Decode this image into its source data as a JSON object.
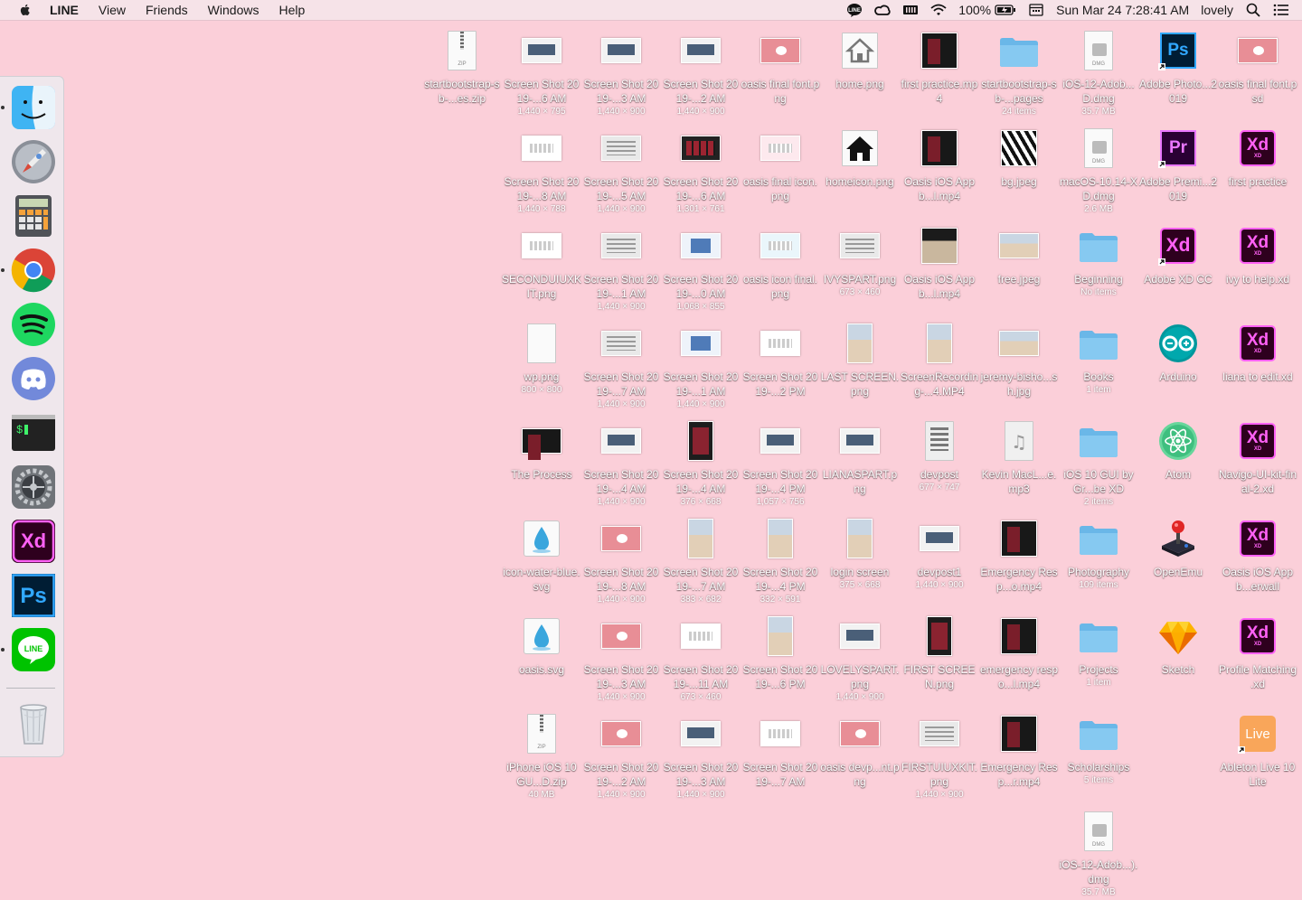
{
  "menubar": {
    "app_name": "LINE",
    "menus": [
      "View",
      "Friends",
      "Windows",
      "Help"
    ],
    "battery": "100%",
    "datetime": "Sun Mar 24  7:28:41 AM",
    "user": "lovely"
  },
  "dock": {
    "apps": [
      {
        "name": "Finder",
        "icon": "finder-icon",
        "running": true
      },
      {
        "name": "Launchpad",
        "icon": "launchpad-icon",
        "running": false
      },
      {
        "name": "Calculator",
        "icon": "calculator-icon",
        "running": false
      },
      {
        "name": "Google Chrome",
        "icon": "chrome-icon",
        "running": true
      },
      {
        "name": "Spotify",
        "icon": "spotify-icon",
        "running": false
      },
      {
        "name": "Discord",
        "icon": "discord-icon",
        "running": false
      },
      {
        "name": "Terminal",
        "icon": "terminal-icon",
        "running": false
      },
      {
        "name": "System Preferences",
        "icon": "system-preferences-icon",
        "running": false
      },
      {
        "name": "Adobe XD",
        "icon": "adobe-xd-icon",
        "running": false
      },
      {
        "name": "Adobe Photoshop",
        "icon": "photoshop-icon",
        "running": false
      },
      {
        "name": "LINE",
        "icon": "line-icon",
        "running": true
      },
      {
        "name": "Trash",
        "icon": "trash-icon",
        "running": false
      }
    ]
  },
  "desktop": {
    "columns": [
      [
        {
          "name": "startbootstrap-sb-...es.zip",
          "info": "",
          "kind": "zip"
        }
      ],
      [
        {
          "name": "Screen Shot 2019-...6 AM",
          "info": "1,440 × 795",
          "kind": "screen"
        },
        {
          "name": "Screen Shot 2019-...8 AM",
          "info": "1,440 × 788",
          "kind": "white"
        },
        {
          "name": "SECONDUIUXKIT.png",
          "info": "",
          "kind": "white"
        },
        {
          "name": "wp.png",
          "info": "800 × 800",
          "kind": "doc-white"
        },
        {
          "name": "The Process",
          "info": "",
          "kind": "video"
        },
        {
          "name": "icon-water-blue.svg",
          "info": "",
          "kind": "water"
        },
        {
          "name": "oasis.svg",
          "info": "",
          "kind": "water"
        },
        {
          "name": "iPhone iOS 10 GU...D.zip",
          "info": "40 MB",
          "kind": "zip"
        }
      ],
      [
        {
          "name": "Screen Shot 2019-...3 AM",
          "info": "1,440 × 900",
          "kind": "screen"
        },
        {
          "name": "Screen Shot 2019-...5 AM",
          "info": "1,440 × 900",
          "kind": "grey"
        },
        {
          "name": "Screen Shot 2019-...1 AM",
          "info": "1,440 × 900",
          "kind": "grey"
        },
        {
          "name": "Screen Shot 2019-...7 AM",
          "info": "1,440 × 900",
          "kind": "grey"
        },
        {
          "name": "Screen Shot 2019-...4 AM",
          "info": "1,440 × 900",
          "kind": "screen"
        },
        {
          "name": "Screen Shot 2019-...8 AM",
          "info": "1,440 × 900",
          "kind": "pink"
        },
        {
          "name": "Screen Shot 2019-...3 AM",
          "info": "1,440 × 900",
          "kind": "pink"
        },
        {
          "name": "Screen Shot 2019-...2 AM",
          "info": "1,440 × 900",
          "kind": "pink"
        }
      ],
      [
        {
          "name": "Screen Shot 2019-...2 AM",
          "info": "1,440 × 900",
          "kind": "screen"
        },
        {
          "name": "Screen Shot 2019-...6 AM",
          "info": "1,301 × 761",
          "kind": "dark"
        },
        {
          "name": "Screen Shot 2019-...0 AM",
          "info": "1,068 × 855",
          "kind": "blue"
        },
        {
          "name": "Screen Shot 2019-...1 AM",
          "info": "1,440 × 900",
          "kind": "blue"
        },
        {
          "name": "Screen Shot 2019-...4 AM",
          "info": "376 × 668",
          "kind": "phone"
        },
        {
          "name": "Screen Shot 2019-...7 AM",
          "info": "383 × 682",
          "kind": "beach-tall"
        },
        {
          "name": "Screen Shot 2019-...11 AM",
          "info": "673 × 460",
          "kind": "white"
        },
        {
          "name": "Screen Shot 2019-...3 AM",
          "info": "1,440 × 900",
          "kind": "screen"
        }
      ],
      [
        {
          "name": "oasis final font.png",
          "info": "",
          "kind": "pink"
        },
        {
          "name": "oasis final icon.png",
          "info": "",
          "kind": "pink-light"
        },
        {
          "name": "oasis icon final.png",
          "info": "",
          "kind": "white-blue"
        },
        {
          "name": "Screen Shot 2019-...2 PM",
          "info": "",
          "kind": "white"
        },
        {
          "name": "Screen Shot 2019-...4 PM",
          "info": "1,057 × 756",
          "kind": "screen"
        },
        {
          "name": "Screen Shot 2019-...4 PM",
          "info": "332 × 591",
          "kind": "beach-tall"
        },
        {
          "name": "Screen Shot 2019-...6 PM",
          "info": "",
          "kind": "beach-tall"
        },
        {
          "name": "Screen Shot 2019-...7 AM",
          "info": "",
          "kind": "white"
        }
      ],
      [
        {
          "name": "home.png",
          "info": "",
          "kind": "home-grey"
        },
        {
          "name": "homeicon.png",
          "info": "",
          "kind": "home-black"
        },
        {
          "name": "IVYSPART.png",
          "info": "673 × 460",
          "kind": "grey"
        },
        {
          "name": "LAST SCREEN.png",
          "info": "",
          "kind": "beach-tall"
        },
        {
          "name": "LIANASPART.png",
          "info": "",
          "kind": "screen"
        },
        {
          "name": "login screen",
          "info": "375 × 668",
          "kind": "beach-tall"
        },
        {
          "name": "LOVELYSPART.png",
          "info": "1,440 × 900",
          "kind": "screen"
        },
        {
          "name": "oasis devp...nt.png",
          "info": "",
          "kind": "pink"
        }
      ],
      [
        {
          "name": "first practice.mp4",
          "info": "",
          "kind": "video-tall"
        },
        {
          "name": "Oasis iOS App b...l.mp4",
          "info": "",
          "kind": "video-tall"
        },
        {
          "name": "Oasis iOS App b...l.mp4",
          "info": "",
          "kind": "beach-dark"
        },
        {
          "name": "ScreenRecording-...4.MP4",
          "info": "",
          "kind": "beach-tall"
        },
        {
          "name": "devpost",
          "info": "677 × 747",
          "kind": "doc-grey"
        },
        {
          "name": "devpost1",
          "info": "1,440 × 900",
          "kind": "screen"
        },
        {
          "name": "FIRST SCREEN.png",
          "info": "",
          "kind": "phone"
        },
        {
          "name": "FIRSTUIUXKIT.png",
          "info": "1,440 × 900",
          "kind": "grey"
        }
      ],
      [
        {
          "name": "startbootstrap-sb-...pages",
          "info": "24 items",
          "kind": "folder"
        },
        {
          "name": "bg.jpeg",
          "info": "",
          "kind": "zebra"
        },
        {
          "name": "free.jpeg",
          "info": "",
          "kind": "beach"
        },
        {
          "name": "jeremy-bisho...sh.jpg",
          "info": "",
          "kind": "beach"
        },
        {
          "name": "Kevin MacL...e.mp3",
          "info": "",
          "kind": "audio"
        },
        {
          "name": "Emergency Resp...o.mp4",
          "info": "",
          "kind": "video-tall"
        },
        {
          "name": "emergency respo...l.mp4",
          "info": "",
          "kind": "video-tall"
        },
        {
          "name": "Emergency Resp...r.mp4",
          "info": "",
          "kind": "video-tall"
        }
      ],
      [
        {
          "name": "iOS-12-Adob...D.dmg",
          "info": "35.7 MB",
          "kind": "dmg"
        },
        {
          "name": "macOS-10.14-XD.dmg",
          "info": "2.6 MB",
          "kind": "dmg"
        },
        {
          "name": "Beginning",
          "info": "No items",
          "kind": "folder"
        },
        {
          "name": "Books",
          "info": "1 item",
          "kind": "folder"
        },
        {
          "name": "iOS 10 GUI by Gr...be XD",
          "info": "2 items",
          "kind": "folder"
        },
        {
          "name": "Photography",
          "info": "109 items",
          "kind": "folder"
        },
        {
          "name": "Projects",
          "info": "1 item",
          "kind": "folder"
        },
        {
          "name": "Scholarships",
          "info": "5 items",
          "kind": "folder"
        },
        {
          "name": "iOS-12-Adob...).dmg",
          "info": "35.7 MB",
          "kind": "dmg"
        }
      ],
      [
        {
          "name": "Adobe Photo...2019",
          "info": "",
          "kind": "ps-alias"
        },
        {
          "name": "Adobe Premi...2019",
          "info": "",
          "kind": "pr-alias"
        },
        {
          "name": "Adobe XD CC",
          "info": "",
          "kind": "xd-alias"
        },
        {
          "name": "Arduino",
          "info": "",
          "kind": "arduino"
        },
        {
          "name": "Atom",
          "info": "",
          "kind": "atom"
        },
        {
          "name": "OpenEmu",
          "info": "",
          "kind": "openemu"
        },
        {
          "name": "Sketch",
          "info": "",
          "kind": "sketch"
        }
      ],
      [
        {
          "name": "oasis final font.psd",
          "info": "",
          "kind": "pink"
        },
        {
          "name": "first practice",
          "info": "",
          "kind": "xd"
        },
        {
          "name": "ivy to help.xd",
          "info": "",
          "kind": "xd"
        },
        {
          "name": "liana to edit.xd",
          "info": "",
          "kind": "xd"
        },
        {
          "name": "Navigo-UI-kit-final-2.xd",
          "info": "",
          "kind": "xd"
        },
        {
          "name": "Oasis iOS App b...erwall",
          "info": "",
          "kind": "xd"
        },
        {
          "name": "Profile Matching .xd",
          "info": "",
          "kind": "xd"
        },
        {
          "name": "Ableton Live 10 Lite",
          "info": "",
          "kind": "live-alias"
        }
      ]
    ]
  },
  "colors": {
    "desktop_bg": "#fbcfd9",
    "folder": "#7cc4ef",
    "xd": "#ff61f6",
    "ps": "#31a8ff"
  }
}
